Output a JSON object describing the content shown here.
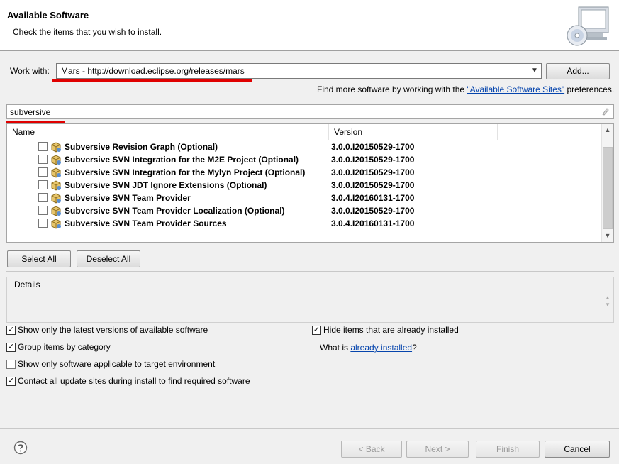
{
  "header": {
    "title": "Available Software",
    "subtitle": "Check the items that you wish to install."
  },
  "work_with": {
    "label": "Work with:",
    "value": "Mars - http://download.eclipse.org/releases/mars",
    "add_button": "Add..."
  },
  "find_more": {
    "prefix": "Find more software by working with the ",
    "link": "\"Available Software Sites\"",
    "suffix": " preferences."
  },
  "filter": {
    "value": "subversive"
  },
  "table": {
    "columns": [
      "Name",
      "Version"
    ],
    "rows": [
      {
        "name": "Subversive Revision Graph (Optional)",
        "version": "3.0.0.I20150529-1700"
      },
      {
        "name": "Subversive SVN Integration for the M2E Project (Optional)",
        "version": "3.0.0.I20150529-1700"
      },
      {
        "name": "Subversive SVN Integration for the Mylyn Project (Optional)",
        "version": "3.0.0.I20150529-1700"
      },
      {
        "name": "Subversive SVN JDT Ignore Extensions (Optional)",
        "version": "3.0.0.I20150529-1700"
      },
      {
        "name": "Subversive SVN Team Provider",
        "version": "3.0.4.I20160131-1700"
      },
      {
        "name": "Subversive SVN Team Provider Localization (Optional)",
        "version": "3.0.0.I20150529-1700"
      },
      {
        "name": "Subversive SVN Team Provider Sources",
        "version": "3.0.4.I20160131-1700"
      }
    ]
  },
  "buttons": {
    "select_all": "Select All",
    "deselect_all": "Deselect All",
    "back": "< Back",
    "next": "Next >",
    "finish": "Finish",
    "cancel": "Cancel"
  },
  "details": {
    "label": "Details"
  },
  "options": {
    "latest_versions": {
      "label": "Show only the latest versions of available software",
      "checked": true
    },
    "group_by_category": {
      "label": "Group items by category",
      "checked": true
    },
    "applicable_only": {
      "label": "Show only software applicable to target environment",
      "checked": false
    },
    "contact_sites": {
      "label": "Contact all update sites during install to find required software",
      "checked": true
    },
    "hide_installed": {
      "label": "Hide items that are already installed",
      "checked": true
    }
  },
  "what_is": {
    "prefix": "What is ",
    "link": "already installed",
    "suffix": "?"
  },
  "icons": {
    "header": "cd-computer-icon",
    "package": "feature-package-icon",
    "help": "help-icon",
    "clear": "clear-filter-icon"
  },
  "colors": {
    "highlight_underline": "#e00000",
    "link": "#0645ad"
  }
}
